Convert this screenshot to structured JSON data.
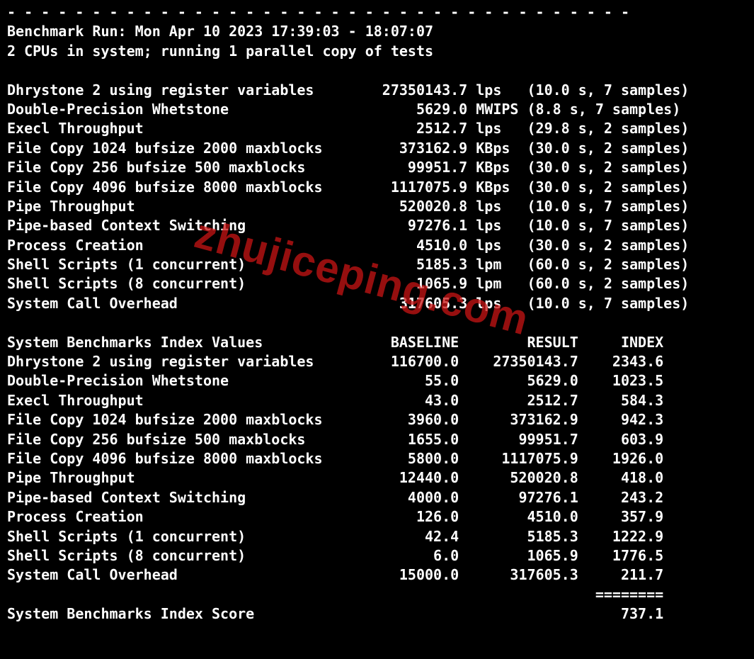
{
  "header": {
    "separator": "- - - - - - - - - - - - - - - - - - - - - - - - - - - - - - - - - - - - -",
    "run_line": "Benchmark Run: Mon Apr 10 2023 17:39:03 - 18:07:07",
    "cpu_line": "2 CPUs in system; running 1 parallel copy of tests"
  },
  "tests": [
    {
      "name": "Dhrystone 2 using register variables",
      "value": "27350143.7",
      "unit": "lps",
      "info": "(10.0 s, 7 samples)"
    },
    {
      "name": "Double-Precision Whetstone",
      "value": "5629.0",
      "unit": "MWIPS",
      "info": "(8.8 s, 7 samples)"
    },
    {
      "name": "Execl Throughput",
      "value": "2512.7",
      "unit": "lps",
      "info": "(29.8 s, 2 samples)"
    },
    {
      "name": "File Copy 1024 bufsize 2000 maxblocks",
      "value": "373162.9",
      "unit": "KBps",
      "info": "(30.0 s, 2 samples)"
    },
    {
      "name": "File Copy 256 bufsize 500 maxblocks",
      "value": "99951.7",
      "unit": "KBps",
      "info": "(30.0 s, 2 samples)"
    },
    {
      "name": "File Copy 4096 bufsize 8000 maxblocks",
      "value": "1117075.9",
      "unit": "KBps",
      "info": "(30.0 s, 2 samples)"
    },
    {
      "name": "Pipe Throughput",
      "value": "520020.8",
      "unit": "lps",
      "info": "(10.0 s, 7 samples)"
    },
    {
      "name": "Pipe-based Context Switching",
      "value": "97276.1",
      "unit": "lps",
      "info": "(10.0 s, 7 samples)"
    },
    {
      "name": "Process Creation",
      "value": "4510.0",
      "unit": "lps",
      "info": "(30.0 s, 2 samples)"
    },
    {
      "name": "Shell Scripts (1 concurrent)",
      "value": "5185.3",
      "unit": "lpm",
      "info": "(60.0 s, 2 samples)"
    },
    {
      "name": "Shell Scripts (8 concurrent)",
      "value": "1065.9",
      "unit": "lpm",
      "info": "(60.0 s, 2 samples)"
    },
    {
      "name": "System Call Overhead",
      "value": "317605.3",
      "unit": "lps",
      "info": "(10.0 s, 7 samples)"
    }
  ],
  "index_header": {
    "title": "System Benchmarks Index Values",
    "col_baseline": "BASELINE",
    "col_result": "RESULT",
    "col_index": "INDEX"
  },
  "index": [
    {
      "name": "Dhrystone 2 using register variables",
      "baseline": "116700.0",
      "result": "27350143.7",
      "index": "2343.6"
    },
    {
      "name": "Double-Precision Whetstone",
      "baseline": "55.0",
      "result": "5629.0",
      "index": "1023.5"
    },
    {
      "name": "Execl Throughput",
      "baseline": "43.0",
      "result": "2512.7",
      "index": "584.3"
    },
    {
      "name": "File Copy 1024 bufsize 2000 maxblocks",
      "baseline": "3960.0",
      "result": "373162.9",
      "index": "942.3"
    },
    {
      "name": "File Copy 256 bufsize 500 maxblocks",
      "baseline": "1655.0",
      "result": "99951.7",
      "index": "603.9"
    },
    {
      "name": "File Copy 4096 bufsize 8000 maxblocks",
      "baseline": "5800.0",
      "result": "1117075.9",
      "index": "1926.0"
    },
    {
      "name": "Pipe Throughput",
      "baseline": "12440.0",
      "result": "520020.8",
      "index": "418.0"
    },
    {
      "name": "Pipe-based Context Switching",
      "baseline": "4000.0",
      "result": "97276.1",
      "index": "243.2"
    },
    {
      "name": "Process Creation",
      "baseline": "126.0",
      "result": "4510.0",
      "index": "357.9"
    },
    {
      "name": "Shell Scripts (1 concurrent)",
      "baseline": "42.4",
      "result": "5185.3",
      "index": "1222.9"
    },
    {
      "name": "Shell Scripts (8 concurrent)",
      "baseline": "6.0",
      "result": "1065.9",
      "index": "1776.5"
    },
    {
      "name": "System Call Overhead",
      "baseline": "15000.0",
      "result": "317605.3",
      "index": "211.7"
    }
  ],
  "score": {
    "rule": "========",
    "label": "System Benchmarks Index Score",
    "value": "737.1"
  },
  "watermark": "zhujiceping.com"
}
